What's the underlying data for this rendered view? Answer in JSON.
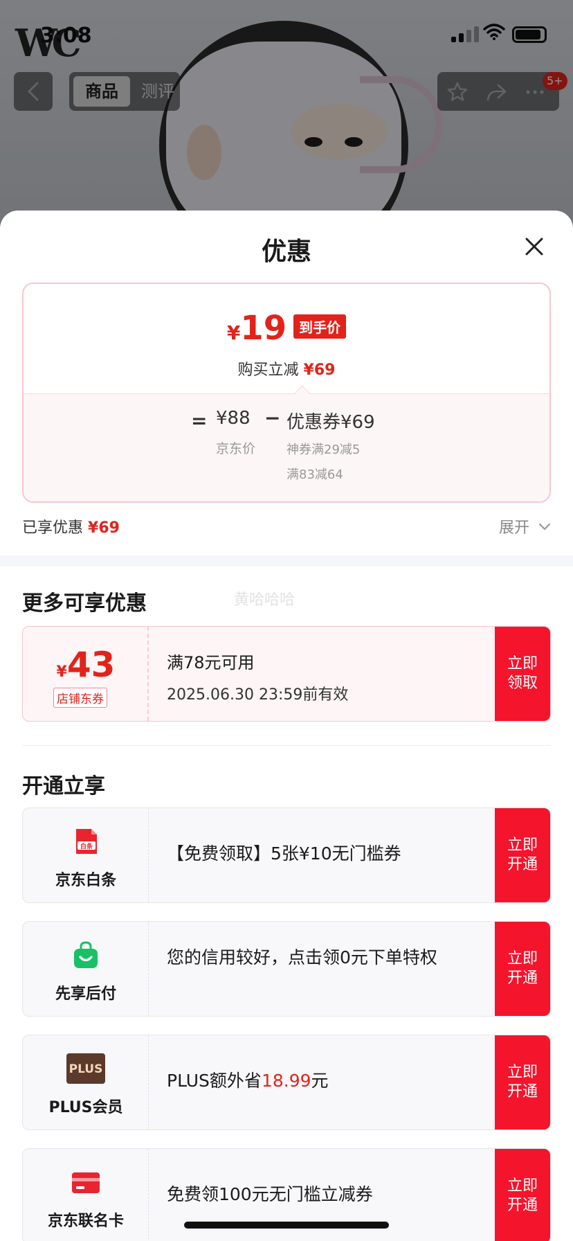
{
  "status": {
    "time": "3:08",
    "logo": "WC"
  },
  "topbar": {
    "tab_active": "商品",
    "tab_other": "测评",
    "badge": "5+"
  },
  "sheet": {
    "title": "优惠",
    "price": {
      "yen": "¥",
      "value": "19",
      "tag": "到手价",
      "reduce_label": "购买立减",
      "reduce_value": "¥69",
      "eq": "=",
      "jd_price": "¥88",
      "jd_label": "京东价",
      "minus": "−",
      "coupon_total": "优惠券¥69",
      "coupon_detail_1": "神券满29减5",
      "coupon_detail_2": "满83减64"
    },
    "enjoyed_label": "已享优惠",
    "enjoyed_value": "¥69",
    "expand_label": "展开",
    "more_title": "更多可享优惠",
    "watermark": "黄哈哈哈",
    "coupon": {
      "yen": "¥",
      "amount": "43",
      "tag": "店铺东券",
      "condition": "满78元可用",
      "expiry": "2025.06.30 23:59前有效",
      "button_line1": "立即",
      "button_line2": "领取"
    },
    "open_title": "开通立享",
    "services": [
      {
        "name": "京东白条",
        "icon": "baitiao-icon",
        "desc": "【免费领取】5张¥10无门槛券",
        "button_line1": "立即",
        "button_line2": "开通"
      },
      {
        "name": "先享后付",
        "icon": "shopping-bag-icon",
        "desc": "您的信用较好，点击领0元下单特权",
        "button_line1": "立即",
        "button_line2": "开通"
      },
      {
        "name": "PLUS会员",
        "icon": "plus-icon",
        "icon_text": "PLUS",
        "desc_pre": "PLUS额外省",
        "desc_hi": "18.99",
        "desc_post": "元",
        "button_line1": "立即",
        "button_line2": "开通"
      },
      {
        "name": "京东联名卡",
        "icon": "card-icon",
        "desc": "免费领100元无门槛立减券",
        "button_line1": "立即",
        "button_line2": "开通"
      }
    ],
    "baitiao_icon_text": "白条"
  },
  "colors": {
    "accent_red": "#e2231a",
    "button_red": "#f4142b"
  }
}
